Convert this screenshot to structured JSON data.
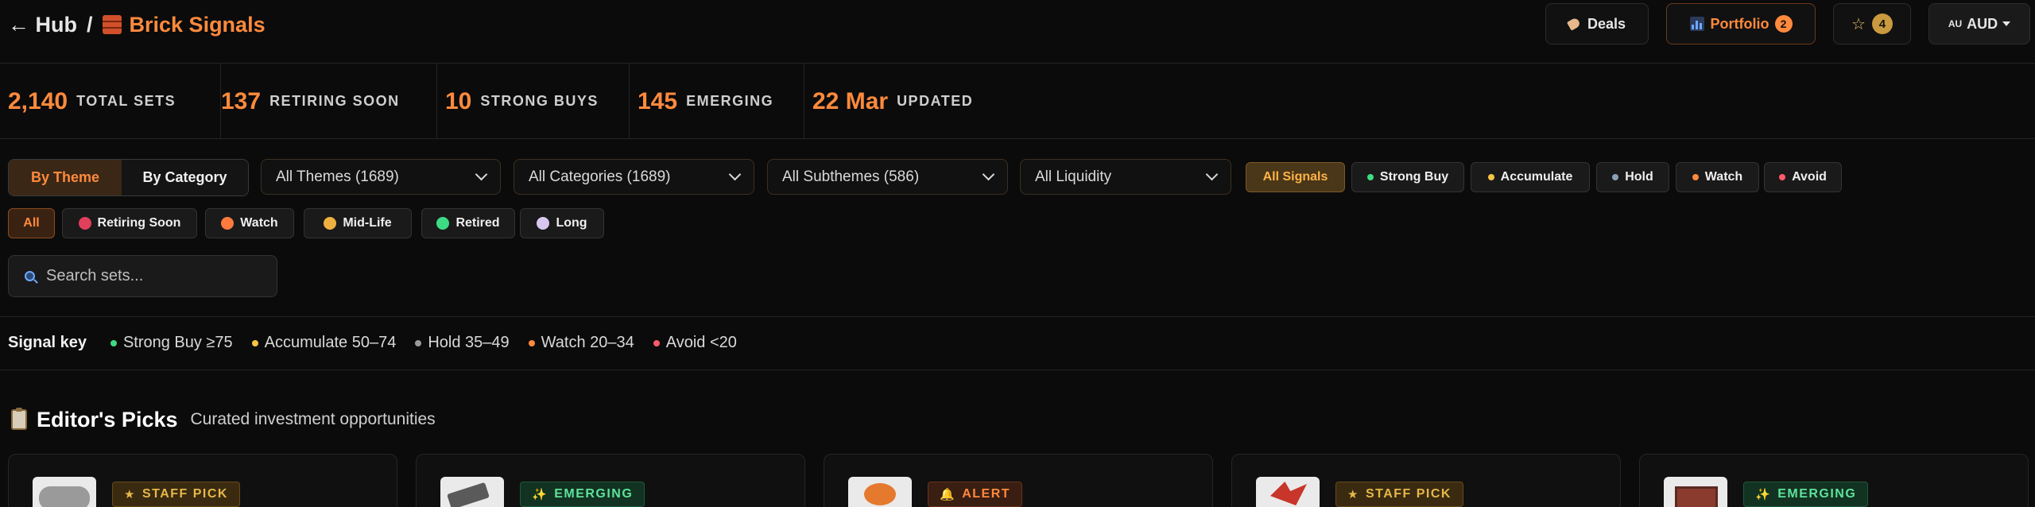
{
  "header": {
    "back_label": "← Hub",
    "separator": "/",
    "brand": "Brick Signals",
    "deals_label": "Deals",
    "portfolio_label": "Portfolio",
    "portfolio_count": "2",
    "favorites_count": "4",
    "currency_flag": "AU",
    "currency_label": "AUD"
  },
  "stats": [
    {
      "value": "2,140",
      "label": "TOTAL SETS"
    },
    {
      "value": "137",
      "label": "RETIRING SOON"
    },
    {
      "value": "10",
      "label": "STRONG BUYS"
    },
    {
      "value": "145",
      "label": "EMERGING"
    },
    {
      "value": "22 Mar",
      "label": "UPDATED"
    }
  ],
  "view_toggle": {
    "theme": "By Theme",
    "category": "By Category",
    "active": "By Theme"
  },
  "selects": {
    "themes": "All Themes (1689)",
    "categories": "All Categories (1689)",
    "subthemes": "All Subthemes (586)",
    "liquidity": "All Liquidity"
  },
  "signal_filters": [
    {
      "label": "All Signals",
      "active": true
    },
    {
      "label": "Strong Buy",
      "color": "#3ddc84"
    },
    {
      "label": "Accumulate",
      "color": "#f5c542"
    },
    {
      "label": "Hold",
      "color": "#8aa0b8"
    },
    {
      "label": "Watch",
      "color": "#ff8a3d"
    },
    {
      "label": "Avoid",
      "color": "#ff5a6a"
    }
  ],
  "lifecycle_filters": [
    {
      "label": "All",
      "active": true
    },
    {
      "label": "Retiring Soon",
      "color": "#e0405a"
    },
    {
      "label": "Watch",
      "color": "#ff7a3d"
    },
    {
      "label": "Mid-Life",
      "color": "#f0b040"
    },
    {
      "label": "Retired",
      "color": "#3ddc84"
    },
    {
      "label": "Long",
      "color": "#d8c8f0"
    }
  ],
  "search": {
    "placeholder": "Search sets..."
  },
  "signal_key": {
    "title": "Signal key",
    "items": [
      {
        "label": "Strong Buy ≥75",
        "color": "#3ddc84"
      },
      {
        "label": "Accumulate 50–74",
        "color": "#f5c542"
      },
      {
        "label": "Hold 35–49",
        "color": "#9a9a9a"
      },
      {
        "label": "Watch 20–34",
        "color": "#ff8a3d"
      },
      {
        "label": "Avoid <20",
        "color": "#ff5a6a"
      }
    ]
  },
  "picks": {
    "title": "Editor's Picks",
    "subtitle": "Curated investment opportunities",
    "cards": [
      {
        "badge": "STAFF PICK",
        "badge_icon": "star-icon",
        "kind": "staff"
      },
      {
        "badge": "EMERGING",
        "badge_icon": "sparkle-icon",
        "kind": "emerg"
      },
      {
        "badge": "ALERT",
        "badge_icon": "bell-icon",
        "kind": "alert"
      },
      {
        "badge": "STAFF PICK",
        "badge_icon": "star-icon",
        "kind": "staff"
      },
      {
        "badge": "EMERGING",
        "badge_icon": "sparkle-icon",
        "kind": "emerg"
      }
    ]
  }
}
